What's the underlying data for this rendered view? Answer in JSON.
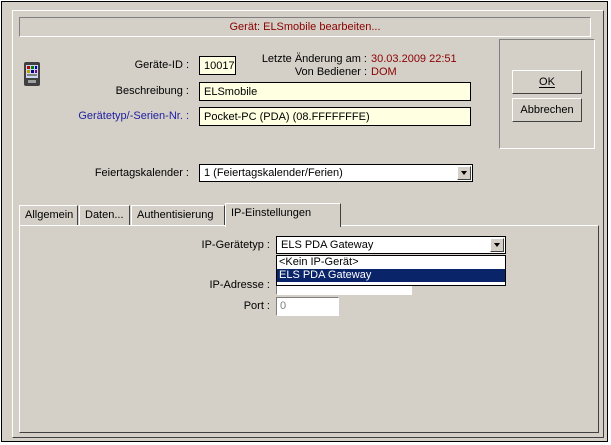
{
  "dialog": {
    "title": "Gerät: ELSmobile bearbeiten..."
  },
  "device": {
    "icon": "pda-device-icon",
    "id_label": "Geräte-ID :",
    "id_value": "10017",
    "last_change_label": "Letzte Änderung am :",
    "last_change_value": "30.03.2009 22:51",
    "operator_label": "Von Bediener :",
    "operator_value": "DOM",
    "description_label": "Beschreibung :",
    "description_value": "ELSmobile",
    "type_label": "Gerätetyp/-Serien-Nr. :",
    "type_value": "Pocket-PC (PDA) (08.FFFFFFFE)"
  },
  "buttons": {
    "ok": "OK",
    "cancel": "Abbrechen"
  },
  "holiday": {
    "label": "Feiertagskalender :",
    "value": "1 (Feiertagskalender/Ferien)"
  },
  "tabs": [
    {
      "label": "Allgemein"
    },
    {
      "label": "Daten..."
    },
    {
      "label": "Authentisierung"
    },
    {
      "label": "IP-Einstellungen"
    }
  ],
  "ip": {
    "type_label": "IP-Gerätetyp :",
    "type_value": "ELS PDA Gateway",
    "options": [
      "<Kein IP-Gerät>",
      "ELS PDA Gateway"
    ],
    "address_label": "IP-Adresse :",
    "port_label": "Port :",
    "port_value": "0"
  },
  "colors": {
    "window": "#d4d0c8",
    "field_yellow": "#ffffe1",
    "dark_red": "#8b0000",
    "blue_label": "#2020a0",
    "selection": "#0a246a"
  }
}
